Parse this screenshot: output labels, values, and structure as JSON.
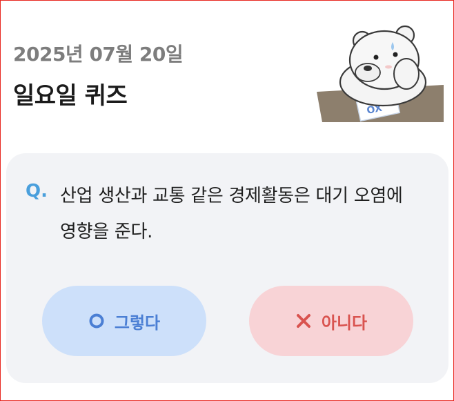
{
  "header": {
    "date": "2025년 07월 20일",
    "title": "일요일 퀴즈"
  },
  "quiz": {
    "q_label": "Q.",
    "question": "산업 생산과 교통 같은 경제활동은 대기 오염에 영향을 준다.",
    "answers": [
      {
        "label": "그렇다",
        "icon": "circle-o-icon",
        "color": "#4b7fd4",
        "bg": "#cde0fa"
      },
      {
        "label": "아니다",
        "icon": "x-mark-icon",
        "color": "#d9534f",
        "bg": "#f8d3d6"
      }
    ]
  },
  "colors": {
    "frame_border": "#e8261f",
    "card_bg": "#f2f3f6",
    "q_accent": "#4a9fdc"
  },
  "illustration": {
    "icon": "bear-mascot-icon",
    "paper_marks": "OX"
  }
}
